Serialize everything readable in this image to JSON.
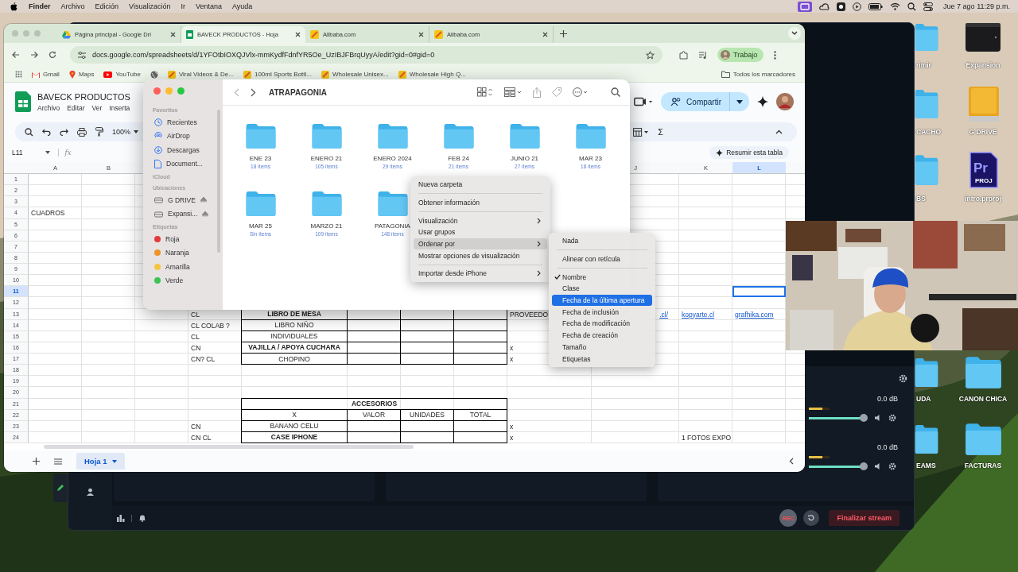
{
  "menubar": {
    "app": "Finder",
    "menus": [
      "Archivo",
      "Edición",
      "Visualización",
      "Ir",
      "Ventana",
      "Ayuda"
    ],
    "clock": "Jue 7 ago 11:29 p.m."
  },
  "browser": {
    "tabs": [
      {
        "title": "Página principal - Google Dri",
        "kind": "drive",
        "selected": false
      },
      {
        "title": "BAVECK PRODUCTOS - Hoja",
        "kind": "sheets",
        "selected": true
      },
      {
        "title": "Alibaba.com",
        "kind": "alibaba",
        "selected": false
      },
      {
        "title": "Alibaba.com",
        "kind": "alibaba",
        "selected": false
      }
    ],
    "url": "docs.google.com/spreadsheets/d/1YFOtbIOXQJVlx-mmKydfFdnfYR5Oe_UzIBJFBrqUyyA/edit?gid=0#gid=0",
    "profile": "Trabajo",
    "bookmarks": [
      {
        "label": "Gmail",
        "kind": "gmail"
      },
      {
        "label": "Maps",
        "kind": "maps"
      },
      {
        "label": "YouTube",
        "kind": "youtube"
      },
      {
        "kind": "globe"
      },
      {
        "label": "Viral Videos & De...",
        "kind": "alibaba"
      },
      {
        "label": "100ml Sports Bottl...",
        "kind": "alibaba"
      },
      {
        "label": "Wholesale Unisex...",
        "kind": "alibaba"
      },
      {
        "label": "Wholesale High Q...",
        "kind": "alibaba"
      }
    ],
    "all_bookmarks": "Todos los marcadores"
  },
  "sheet": {
    "title": "BAVECK PRODUCTOS",
    "menus": [
      "Archivo",
      "Editar",
      "Ver",
      "Inserta"
    ],
    "zoom": "100%",
    "cell_ref": "L11",
    "fx": "fx",
    "share": "Compartir",
    "summarize": "Resumir esta tabla",
    "sum_symbol": "Σ",
    "columns": [
      {
        "label": "A",
        "selected": false
      },
      {
        "label": "B",
        "selected": false
      },
      {},
      {},
      {},
      {},
      {},
      {},
      {},
      {
        "label": "J",
        "selected": false
      },
      {
        "label": "K",
        "selected": false
      },
      {
        "label": "L",
        "selected": true
      }
    ],
    "rows": [
      {
        "number": "1",
        "selected": false
      },
      {
        "number": "2",
        "selected": false
      },
      {
        "number": "3",
        "selected": false
      },
      {
        "number": "4",
        "selected": false,
        "cells": [
          {
            "text": "CUADROS"
          }
        ]
      },
      {
        "number": "5",
        "selected": false
      },
      {
        "number": "6",
        "selected": false
      },
      {
        "number": "7",
        "selected": false
      },
      {
        "number": "8",
        "selected": false
      },
      {
        "number": "9",
        "selected": false
      },
      {
        "number": "10",
        "selected": false
      },
      {
        "number": "11",
        "selected": true,
        "cells": [
          {},
          {},
          {},
          {},
          {},
          {},
          {},
          {},
          {},
          {},
          {},
          {
            "selected": true
          }
        ]
      },
      {
        "number": "12",
        "selected": false
      },
      {
        "number": "13",
        "selected": false,
        "cells": [
          {},
          {},
          {},
          {
            "text": "CL"
          },
          {
            "text": "LIBRO DE MESA",
            "bold": true,
            "bordered": true
          },
          {
            "bordered": true
          },
          {
            "bordered": true
          },
          {
            "bordered": true
          },
          {
            "text": "PROVEEDO"
          },
          {
            "text": ".cl/",
            "link": true,
            "kind": "clipped"
          },
          {
            "text": "kopyarte.cl",
            "link": true
          },
          {
            "text": "grafhika.com",
            "link": true
          }
        ]
      },
      {
        "number": "14",
        "selected": false,
        "cells": [
          {},
          {},
          {},
          {
            "text": "CL COLAB ?"
          },
          {
            "text": "LIBRO NIÑO",
            "bordered": true
          },
          {
            "bordered": true
          },
          {
            "bordered": true
          },
          {
            "bordered": true
          }
        ]
      },
      {
        "number": "15",
        "selected": false,
        "cells": [
          {},
          {},
          {},
          {
            "text": "CL"
          },
          {
            "text": "INDIVIDUALES",
            "bordered": true
          },
          {
            "bordered": true
          },
          {
            "bordered": true
          },
          {
            "bordered": true
          }
        ]
      },
      {
        "number": "16",
        "selected": false,
        "cells": [
          {},
          {},
          {},
          {
            "text": "CN"
          },
          {
            "text": "VAJILLA / APOYA CUCHARA",
            "bold": true,
            "bordered": true
          },
          {
            "bordered": true
          },
          {
            "bordered": true
          },
          {
            "bordered": true
          },
          {
            "text": "x"
          }
        ]
      },
      {
        "number": "17",
        "selected": false,
        "cells": [
          {},
          {},
          {},
          {
            "text": "CN? CL"
          },
          {
            "text": "CHOPINO",
            "bordered": true
          },
          {
            "bordered": true
          },
          {
            "bordered": true
          },
          {
            "bordered": true
          },
          {
            "text": "x"
          }
        ]
      },
      {
        "number": "18",
        "selected": false
      },
      {
        "number": "19",
        "selected": false
      },
      {
        "number": "20",
        "selected": false
      },
      {
        "number": "21",
        "selected": false,
        "cells": [
          {},
          {},
          {},
          {},
          {
            "text": "ACCESORIOS",
            "bold": true,
            "bordered": true,
            "kind": "merged"
          }
        ]
      },
      {
        "number": "22",
        "selected": false,
        "cells": [
          {},
          {},
          {},
          {},
          {
            "text": "X",
            "bordered": true
          },
          {
            "text": "VALOR",
            "bordered": true
          },
          {
            "text": "UNIDADES",
            "bordered": true
          },
          {
            "text": "TOTAL",
            "bordered": true
          }
        ]
      },
      {
        "number": "23",
        "selected": false,
        "cells": [
          {},
          {},
          {},
          {
            "text": "CN"
          },
          {
            "text": "BANANO CELU",
            "bordered": true
          },
          {
            "bordered": true
          },
          {
            "bordered": true
          },
          {
            "bordered": true
          },
          {
            "text": "x"
          }
        ]
      },
      {
        "number": "24",
        "selected": false,
        "cells": [
          {},
          {},
          {},
          {
            "text": "CN CL"
          },
          {
            "text": "CASE IPHONE",
            "bold": true,
            "bordered": true
          },
          {
            "bordered": true
          },
          {
            "bordered": true
          },
          {
            "bordered": true
          },
          {
            "text": "x"
          },
          {},
          {
            "text": "1 FOTOS EXPO"
          }
        ]
      }
    ],
    "sheet_tabs": [
      {
        "label": "Hoja 1",
        "selected": true
      }
    ]
  },
  "finder": {
    "path": "ATRAPAGONIA",
    "sidebar": [
      {
        "heading": "Favoritos",
        "items": [
          {
            "label": "Recientes",
            "kind": "clock"
          },
          {
            "label": "AirDrop",
            "kind": "airdrop"
          },
          {
            "label": "Descargas",
            "kind": "download"
          },
          {
            "label": "Document...",
            "kind": "document"
          }
        ]
      },
      {
        "heading": "iCloud"
      },
      {
        "heading": "Ubicaciones",
        "items": [
          {
            "label": "G DRIVE",
            "kind": "drive"
          },
          {
            "label": "Expansi...",
            "kind": "drive"
          }
        ]
      },
      {
        "heading": "Etiquetas",
        "items": [
          {
            "label": "Roja",
            "kind": "tag",
            "color": "#e5393b"
          },
          {
            "label": "Naranja",
            "kind": "tag",
            "color": "#f0922b"
          },
          {
            "label": "Amarilla",
            "kind": "tag",
            "color": "#f5c542"
          },
          {
            "label": "Verde",
            "kind": "tag",
            "color": "#3cc454"
          }
        ]
      }
    ],
    "folders": [
      {
        "name": "ENE 23",
        "count": "18 ítems"
      },
      {
        "name": "ENERO 21",
        "count": "105 ítems"
      },
      {
        "name": "ENERO 2024",
        "count": "29 ítems"
      },
      {
        "name": "FEB 24",
        "count": "21 ítems"
      },
      {
        "name": "JUNIO 21",
        "count": "27 ítems"
      },
      {
        "name": "MAR 23",
        "count": "18 ítems"
      },
      {
        "name": "MAR 25",
        "count": "Sin ítems"
      },
      {
        "name": "MARZO 21",
        "count": "109 ítems"
      },
      {
        "name": "PATAGONIA",
        "count": "148 ítems"
      }
    ]
  },
  "context_menu": {
    "groups": [
      [
        {
          "label": "Nueva carpeta",
          "has_submenu": false,
          "selected": false
        }
      ],
      [
        {
          "label": "Obtener información",
          "has_submenu": false,
          "selected": false
        }
      ],
      [
        {
          "label": "Visualización",
          "has_submenu": true,
          "selected": false
        },
        {
          "label": "Usar grupos",
          "has_submenu": false,
          "selected": false
        },
        {
          "label": "Ordenar por",
          "has_submenu": true,
          "selected": true
        },
        {
          "label": "Mostrar opciones de visualización",
          "has_submenu": false,
          "selected": false
        }
      ],
      [
        {
          "label": "Importar desde iPhone",
          "has_submenu": true,
          "selected": false
        }
      ]
    ]
  },
  "sort_submenu": {
    "groups": [
      [
        {
          "label": "Nada",
          "checked": false,
          "selected": false
        }
      ],
      [
        {
          "label": "Alinear con retícula",
          "checked": false,
          "selected": false
        }
      ],
      [
        {
          "label": "Nombre",
          "checked": true,
          "selected": false
        },
        {
          "label": "Clase",
          "checked": false,
          "selected": false
        },
        {
          "label": "Fecha de la última apertura",
          "checked": false,
          "selected": true
        },
        {
          "label": "Fecha de inclusión",
          "checked": false,
          "selected": false
        },
        {
          "label": "Fecha de modificación",
          "checked": false,
          "selected": false
        },
        {
          "label": "Fecha de creación",
          "checked": false,
          "selected": false
        },
        {
          "label": "Tamaño",
          "checked": false,
          "selected": false
        },
        {
          "label": "Etiquetas",
          "checked": false,
          "selected": false
        }
      ]
    ]
  },
  "obs": {
    "mixer": [
      {
        "reading": "0.0 dB",
        "level": 1
      },
      {
        "reading": "0.0 dB",
        "level": 1
      }
    ],
    "rec": "REC",
    "end_stream": "Finalizar stream"
  },
  "desktop_icons": [
    {
      "label": "rimir",
      "kind": "folder"
    },
    {
      "label": "CACHO",
      "kind": "folder"
    },
    {
      "label": "BS",
      "kind": "folder"
    },
    {
      "label": "UDA",
      "kind": "folder"
    },
    {
      "label": "EAMS",
      "kind": "folder"
    },
    {
      "label": "Expansion",
      "kind": "black-drive"
    },
    {
      "label": "G DRIVE",
      "kind": "yellow-drive"
    },
    {
      "label": "intro.prproj",
      "kind": "premiere",
      "badge": "Pr",
      "tag": "PROJ"
    },
    {
      "label": "CANON CHICA",
      "kind": "folder"
    },
    {
      "label": "FACTURAS",
      "kind": "folder"
    }
  ]
}
